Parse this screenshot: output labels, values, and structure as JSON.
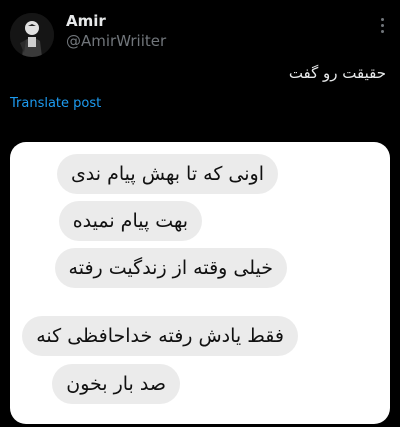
{
  "post": {
    "author_name": "Amir",
    "author_handle": "@AmirWriiter",
    "text": "حقیقت رو گفت",
    "translate_label": "Translate post"
  },
  "icons": {
    "more": "more-vertical-icon",
    "avatar": "profile-avatar"
  },
  "messages": [
    "اونی که تا بهش پیام ندی",
    "بهت پیام نمیده",
    "خیلی وقته از زندگیت رفته",
    "فقط یادش رفته خداحافظی کنه",
    "صد بار بخون"
  ],
  "colors": {
    "background": "#000000",
    "link": "#1d9bf0",
    "muted": "#71767b",
    "bubble": "#ebebeb"
  }
}
